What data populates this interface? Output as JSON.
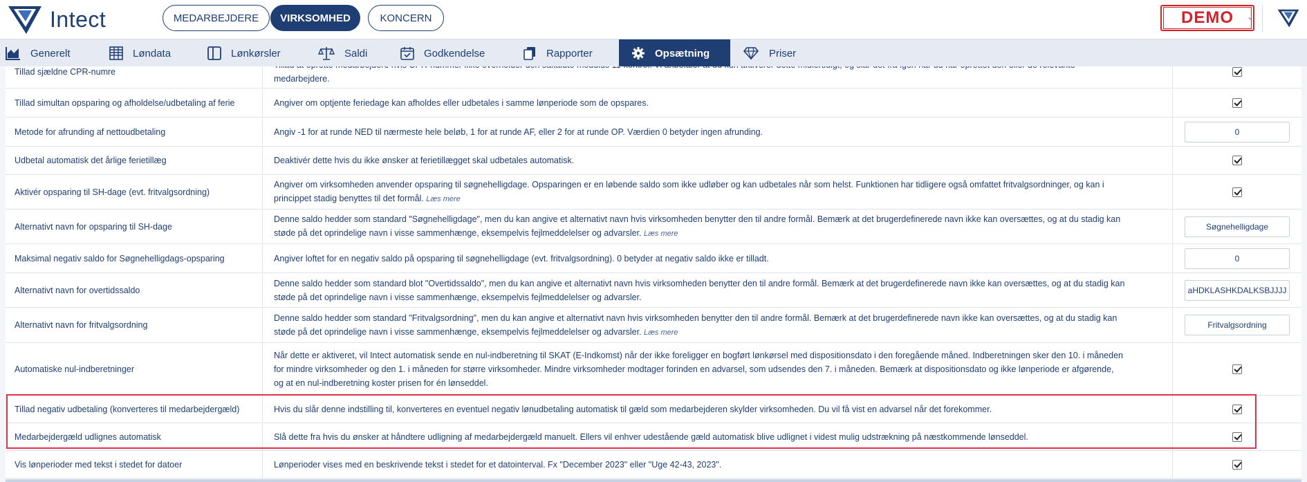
{
  "app": {
    "name": "Intect"
  },
  "header": {
    "tabs": [
      {
        "label": "MEDARBEJDERE",
        "active": false
      },
      {
        "label": "VIRKSOMHED",
        "active": true
      },
      {
        "label": "KONCERN",
        "active": false
      }
    ],
    "demo_label": "DEMO",
    "colors": {
      "primary": "#1f3e74",
      "demo_red": "#d3232a"
    }
  },
  "nav": {
    "items": [
      {
        "label": "Generelt",
        "icon": "area-chart-icon",
        "active": false
      },
      {
        "label": "Løndata",
        "icon": "table-grid-icon",
        "active": false
      },
      {
        "label": "Lønkørsler",
        "icon": "panel-columns-icon",
        "active": false
      },
      {
        "label": "Saldi",
        "icon": "scale-balance-icon",
        "active": false
      },
      {
        "label": "Godkendelse",
        "icon": "calendar-check-icon",
        "active": false
      },
      {
        "label": "Rapporter",
        "icon": "copy-documents-icon",
        "active": false
      },
      {
        "label": "Opsætning",
        "icon": "gear-icon",
        "active": true
      },
      {
        "label": "Priser",
        "icon": "diamond-icon",
        "active": false
      }
    ]
  },
  "settings": [
    {
      "name": "Tillad sjældne CPR-numre",
      "desc": [
        "Tillad at oprette medarbejdere hvis CPR-nummer ikke overholder den såkaldte modulus 11-kontrol. Vi anbefaler at du kun aktiverer dette midlertidigt, og slår det fra igen når du har oprettet den eller de relevante",
        "medarbejdere."
      ],
      "more": "",
      "control": "checkbox",
      "checked": true
    },
    {
      "name": "Tillad simultan opsparing og afholdelse/udbetaling af ferie",
      "desc": [
        "Angiver om optjente feriedage kan afholdes eller udbetales i samme lønperiode som de opspares."
      ],
      "more": "",
      "control": "checkbox",
      "checked": true
    },
    {
      "name": "Metode for afrunding af nettoudbetaling",
      "desc": [
        "Angiv -1 for at runde NED til nærmeste hele beløb, 1 for at runde AF, eller 2 for at runde OP. Værdien 0 betyder ingen afrunding."
      ],
      "more": "",
      "control": "input",
      "value": "0"
    },
    {
      "name": "Udbetal automatisk det årlige ferietillæg",
      "desc": [
        "Deaktivér dette hvis du ikke ønsker at ferietillægget skal udbetales automatisk."
      ],
      "more": "",
      "control": "checkbox",
      "checked": true
    },
    {
      "name": "Aktivér opsparing til SH-dage (evt. fritvalgsordning)",
      "desc": [
        "Angiver om virksomheden anvender opsparing til søgnehelligdage. Opsparingen er en løbende saldo som ikke udløber og kan udbetales når som helst. Funktionen har tidligere også omfattet fritvalgsordninger, og kan i",
        "princippet stadig benyttes til det formål."
      ],
      "more": "Læs mere",
      "control": "checkbox",
      "checked": true
    },
    {
      "name": "Alternativt navn for opsparing til SH-dage",
      "desc": [
        "Denne saldo hedder som standard \"Søgnehelligdage\", men du kan angive et alternativt navn hvis virksomheden benytter den til andre formål. Bemærk at det brugerdefinerede navn ikke kan oversættes, og at du stadig kan",
        "støde på det oprindelige navn i visse sammenhænge, eksempelvis fejlmeddelelser og advarsler."
      ],
      "more": "Læs mere",
      "control": "input",
      "value": "Søgnehelligdage"
    },
    {
      "name": "Maksimal negativ saldo for Søgnehelligdags-opsparing",
      "desc": [
        "Angiver loftet for en negativ saldo på opsparing til søgnehelligdage (evt. fritvalgsordning). 0 betyder at negativ saldo ikke er tilladt."
      ],
      "more": "",
      "control": "input",
      "value": "0"
    },
    {
      "name": "Alternativt navn for overtidssaldo",
      "desc": [
        "Denne saldo hedder som standard blot \"Overtidssaldo\", men du kan angive et alternativt navn hvis virksomheden benytter den til andre formål. Bemærk at det brugerdefinerede navn ikke kan oversættes, og at du stadig kan",
        "støde på det oprindelige navn i visse sammenhænge, eksempelvis fejlmeddelelser og advarsler."
      ],
      "more": "",
      "control": "input",
      "value": "aHDKLASHKDALKSBJJJJ"
    },
    {
      "name": "Alternativt navn for fritvalgsordning",
      "desc": [
        "Denne saldo hedder som standard \"Fritvalgsordning\", men du kan angive et alternativt navn hvis virksomheden benytter den til andre formål. Bemærk at det brugerdefinerede navn ikke kan oversættes, og at du stadig kan",
        "støde på det oprindelige navn i visse sammenhænge, eksempelvis fejlmeddelelser og advarsler."
      ],
      "more": "Læs mere",
      "control": "input",
      "value": "Fritvalgsordning"
    },
    {
      "name": "Automatiske nul-indberetninger",
      "desc": [
        "Når dette er aktiveret, vil Intect automatisk sende en nul-indberetning til SKAT (E-Indkomst) når der ikke foreligger en bogført lønkørsel med dispositionsdato i den foregående måned. Indberetningen sker den 10. i måneden",
        "for mindre virksomheder og den 1. i måneden for større virksomheder. Mindre virksomheder modtager forinden en advarsel, som udsendes den 7. i måneden. Bemærk at dispositionsdato og ikke lønperiode er afgørende,",
        "og at en nul-indberetning koster prisen for én lønseddel."
      ],
      "more": "",
      "control": "checkbox",
      "checked": true
    },
    {
      "name": "Tillad negativ udbetaling (konverteres til medarbejdergæld)",
      "desc": [
        "Hvis du slår denne indstilling til, konverteres en eventuel negativ lønudbetaling automatisk til gæld som medarbejderen skylder virksomheden. Du vil få vist en advarsel når det forekommer."
      ],
      "more": "",
      "control": "checkbox",
      "checked": true
    },
    {
      "name": "Medarbejdergæld udlignes automatisk",
      "desc": [
        "Slå dette fra hvis du ønsker at håndtere udligning af medarbejdergæld manuelt. Ellers vil enhver udestående gæld automatisk blive udlignet i videst mulig udstrækning på næstkommende lønseddel."
      ],
      "more": "",
      "control": "checkbox",
      "checked": true
    },
    {
      "name": "Vis lønperioder med tekst i stedet for datoer",
      "desc": [
        "Lønperioder vises med en beskrivende tekst i stedet for et datointerval. Fx \"December 2023\" eller \"Uge 42-43, 2023\"."
      ],
      "more": "",
      "control": "checkbox",
      "checked": true
    }
  ]
}
